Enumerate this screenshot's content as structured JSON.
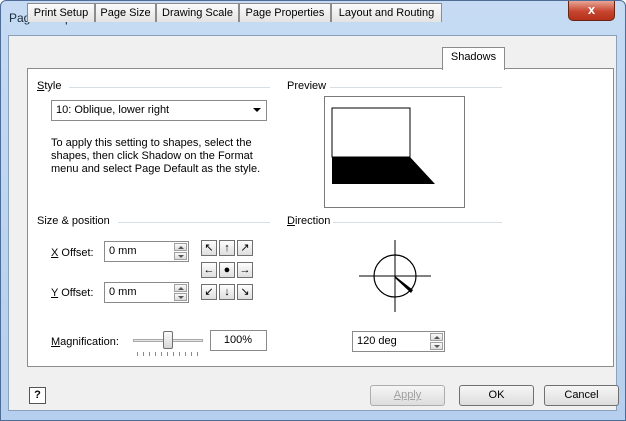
{
  "window": {
    "title": "Page Setup",
    "close_label": "x"
  },
  "tabs": [
    {
      "label": "Print Setup"
    },
    {
      "label": "Page Size"
    },
    {
      "label": "Drawing Scale"
    },
    {
      "label": "Page Properties"
    },
    {
      "label": "Layout and Routing"
    },
    {
      "label": "Shadows"
    }
  ],
  "style": {
    "group_label_u": "S",
    "group_label_rest": "tyle",
    "selected": "10: Oblique, lower right",
    "description": "To apply this setting to shapes, select the shapes, then click Shadow on the Format menu and select Page Default as the style."
  },
  "preview": {
    "label": "Preview"
  },
  "size_position": {
    "group_label": "Size & position",
    "x_offset_u": "X",
    "x_offset_rest": " Offset:",
    "x_offset_value": "0 mm",
    "y_offset_u": "Y",
    "y_offset_rest": " Offset:",
    "y_offset_value": "0 mm",
    "magnification_u": "M",
    "magnification_rest": "agnification:",
    "magnification_value": "100%",
    "magnification_level_percent": 100
  },
  "direction": {
    "label_u": "D",
    "label_rest": "irection",
    "value": "120 deg"
  },
  "footer": {
    "help_glyph": "?",
    "apply_label": "Apply",
    "ok_label": "OK",
    "cancel_label": "Cancel"
  },
  "icons": [
    "close-icon",
    "help-icon",
    "arrow-up-left-icon",
    "arrow-up-icon",
    "arrow-up-right-icon",
    "arrow-left-icon",
    "center-dot-icon",
    "arrow-right-icon",
    "arrow-down-left-icon",
    "arrow-down-icon",
    "arrow-down-right-icon",
    "dropdown-arrow-icon"
  ]
}
